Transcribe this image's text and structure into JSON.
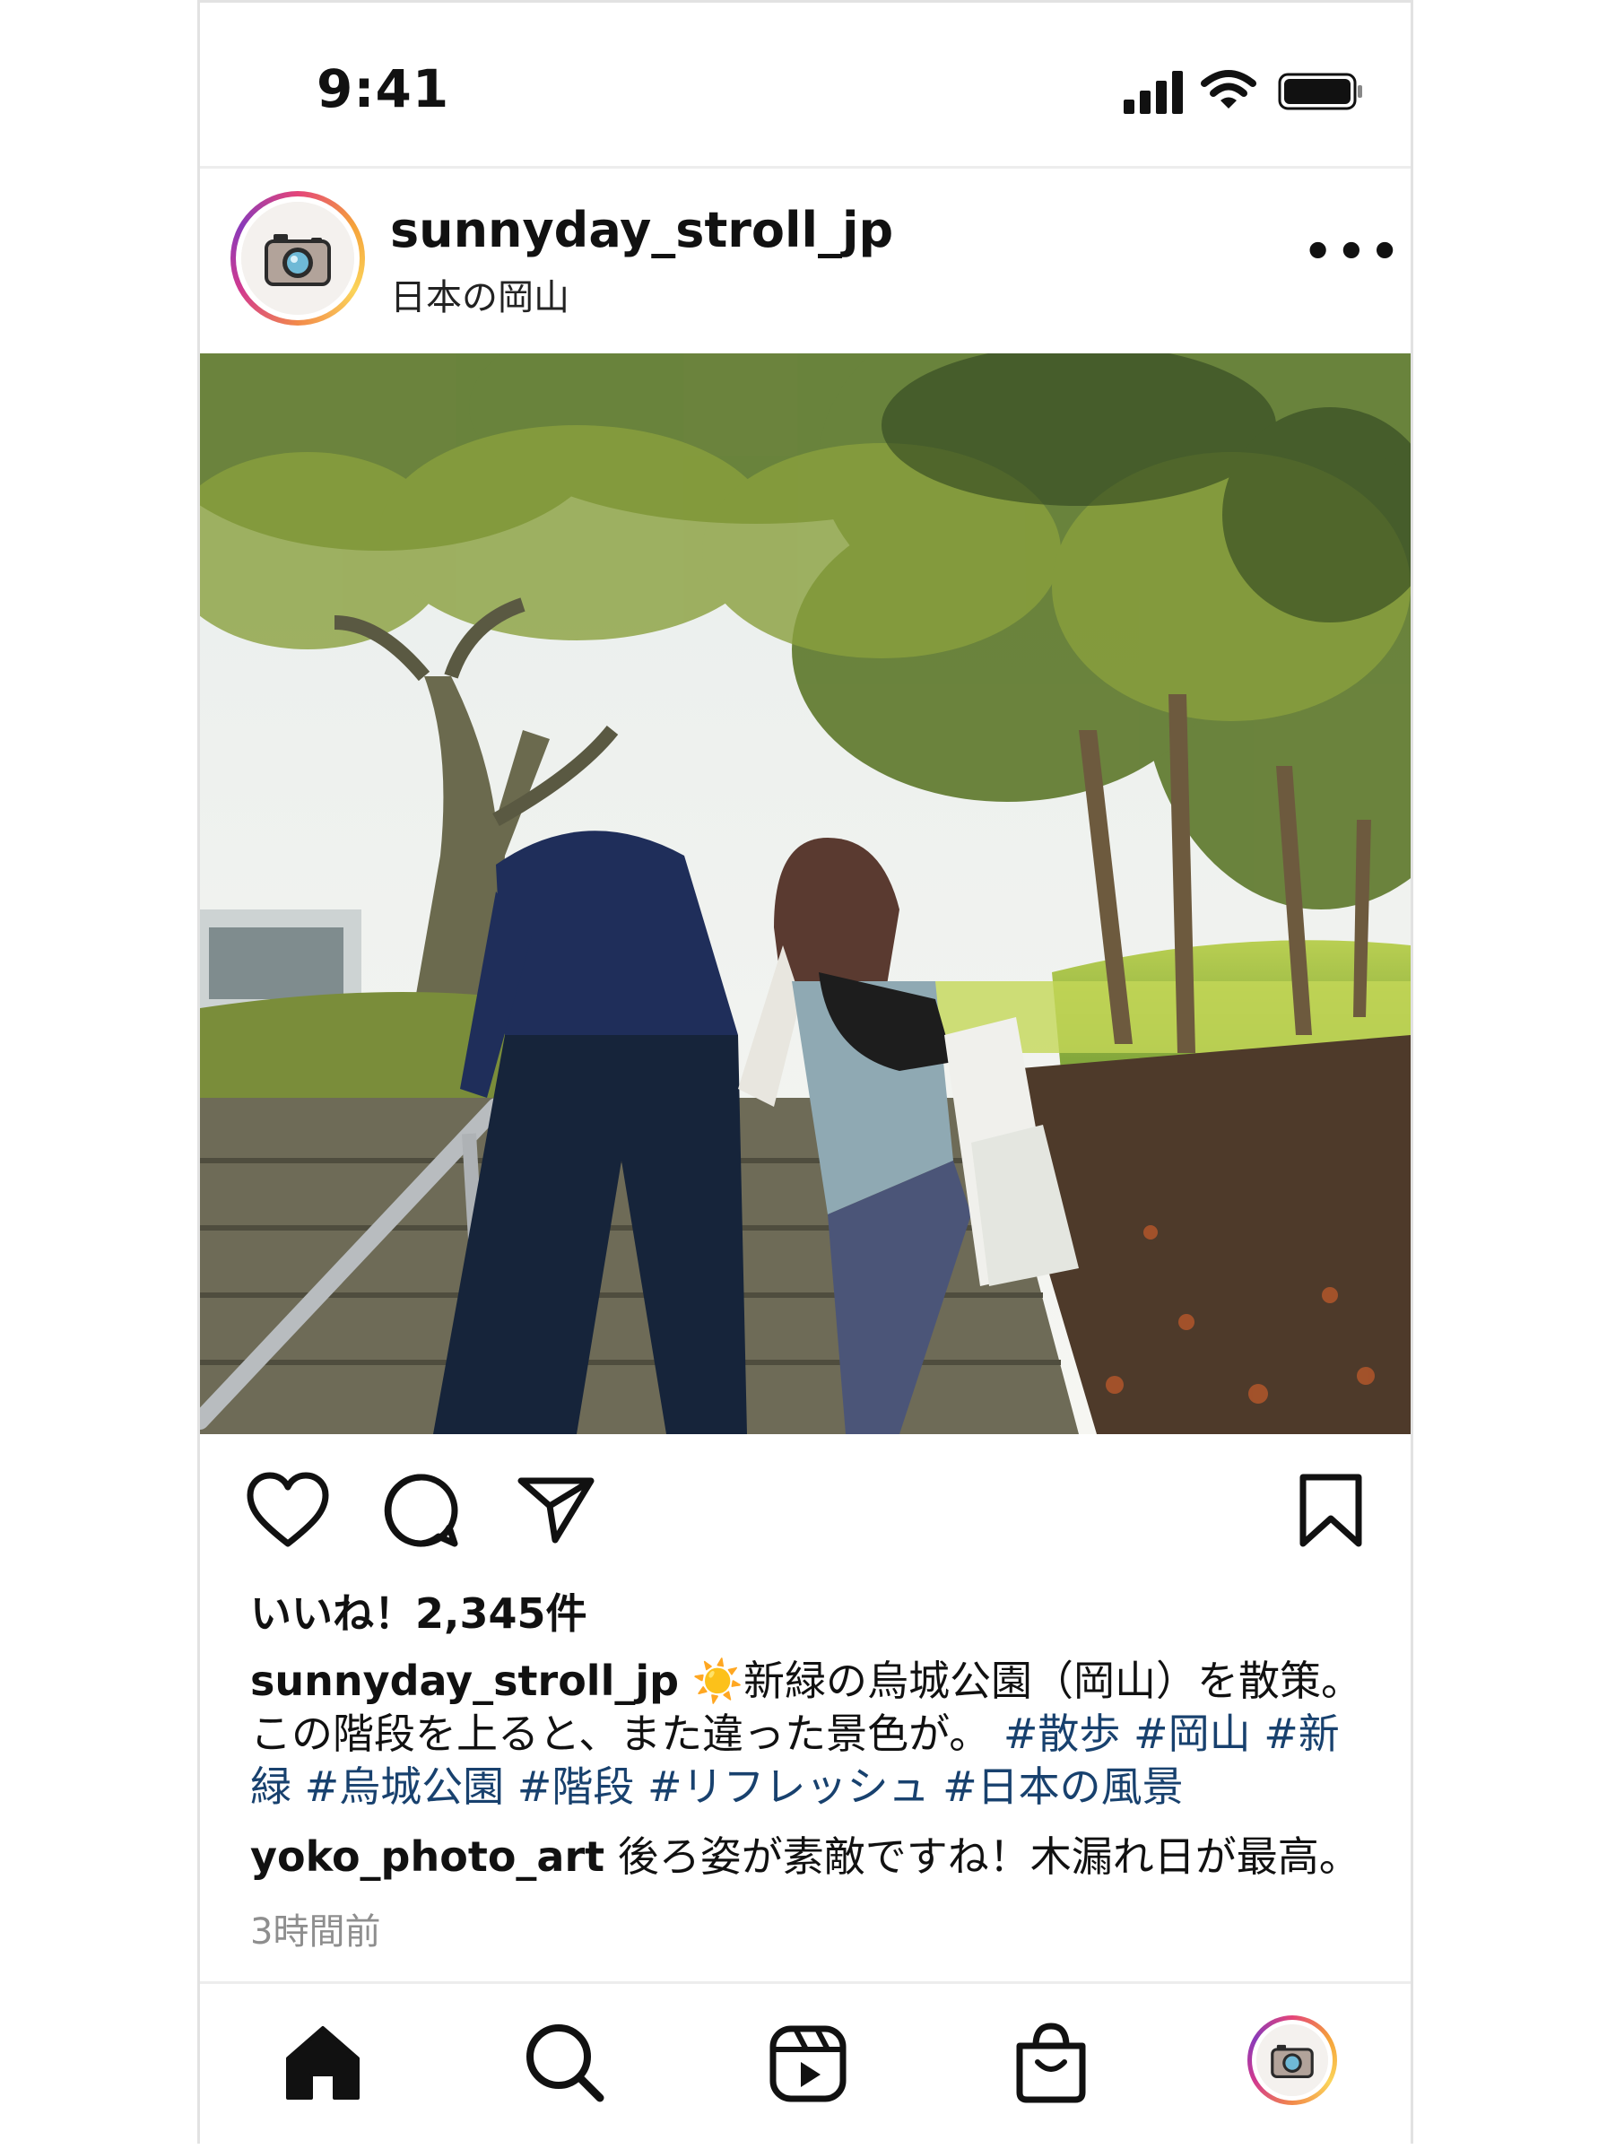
{
  "status_bar": {
    "time": "9:41"
  },
  "post": {
    "username": "sunnyday_stroll_jp",
    "location": "日本の岡山",
    "more_label": "•••",
    "likes": "いいね！2,345件",
    "caption_user": "sunnyday_stroll_jp",
    "caption_emoji": "☀️",
    "caption_text": "新緑の烏城公園（岡山）を散策。この階段を上ると、また違った景色が。",
    "hashtags": [
      "#散歩",
      "#岡山",
      "#新緑",
      "#烏城公園",
      "#階段",
      "#リフレッシュ",
      "#日本の風景"
    ],
    "comment_user": "yoko_photo_art",
    "comment_text": "後ろ姿が素敵ですね！木漏れ日が最高。",
    "time_ago": "3時間前"
  },
  "actions": [
    "heart-icon",
    "comment-icon",
    "share-icon",
    "bookmark-icon"
  ],
  "tab_bar": [
    "home-icon",
    "search-icon",
    "reels-icon",
    "shop-icon",
    "profile-avatar"
  ]
}
